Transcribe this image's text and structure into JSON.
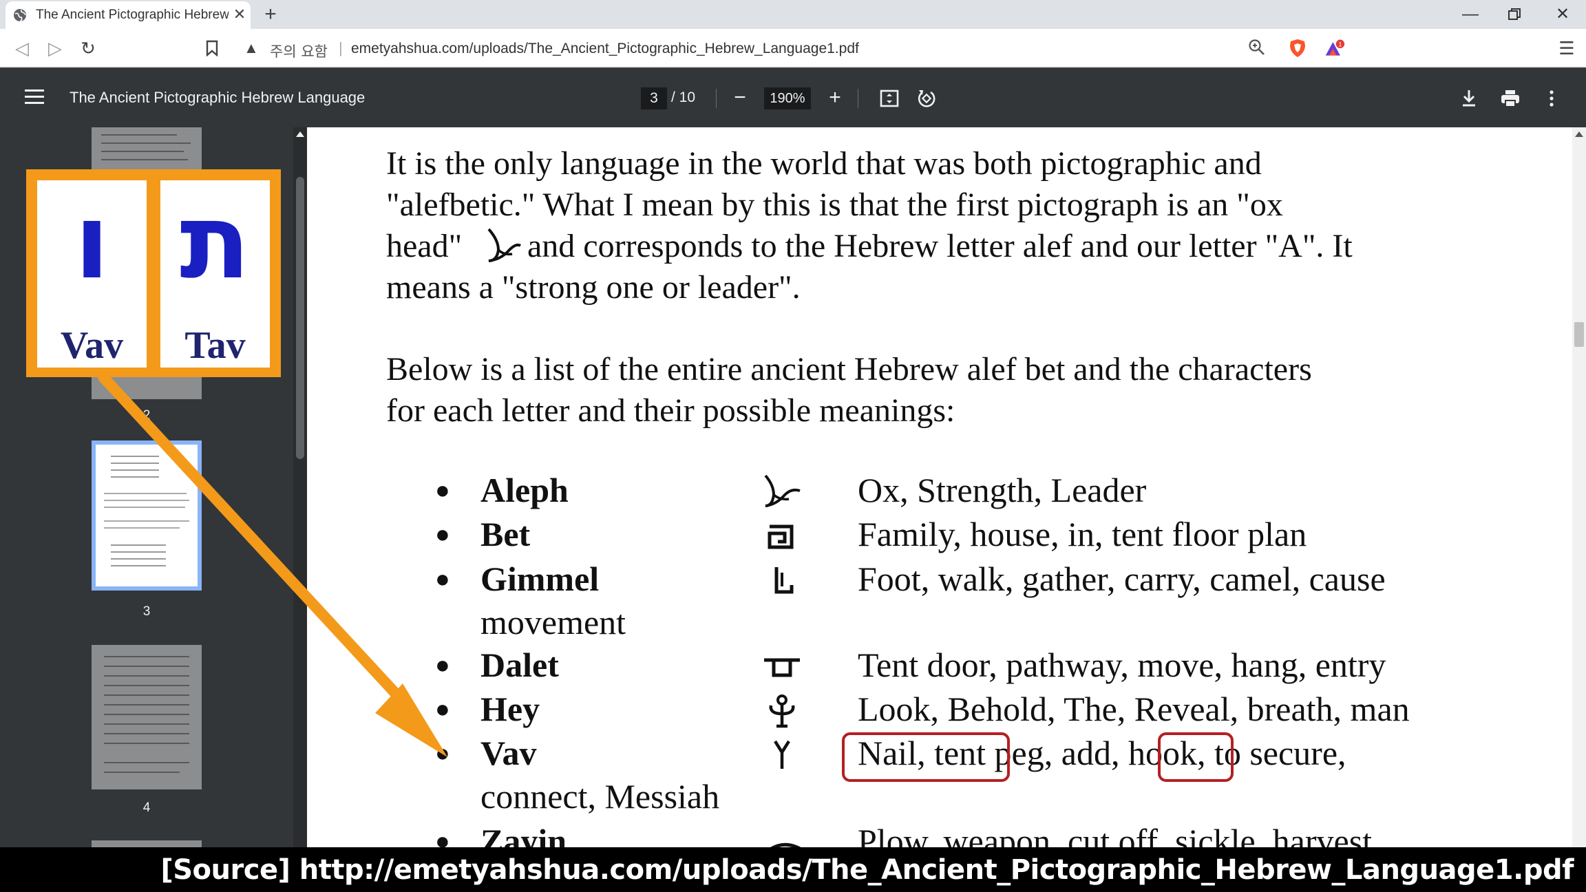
{
  "browser": {
    "tab_title": "The Ancient Pictographic Hebrew Language",
    "new_tab_icon": "plus-icon",
    "security_label": "주의 요함",
    "url": "emetyahshua.com/uploads/The_Ancient_Pictographic_Hebrew_Language1.pdf",
    "extensions": [
      "brave-shield-icon",
      "brave-rewards-icon"
    ]
  },
  "pdf_viewer": {
    "title": "The Ancient Pictographic Hebrew Language",
    "page_current": "3",
    "page_total": "/ 10",
    "zoom": "190%",
    "thumbnails": [
      {
        "label": "2"
      },
      {
        "label": "3",
        "selected": true
      },
      {
        "label": "4"
      }
    ]
  },
  "document": {
    "intro": "It is the only language in the world that was both pictographic and \"alefbetic.\" What I mean by this is that the first pictograph is an \"ox head\" and corresponds to the Hebrew letter alef and our letter \"A\". It means a \"strong one or leader\".",
    "intro_lines": [
      "It is the only language in the world that was both pictographic and",
      "\"alefbetic.\" What I mean by this is that the first pictograph is an \"ox",
      "head\"",
      "and corresponds to the Hebrew letter alef and our letter \"A\". It",
      "means a \"strong one or leader\"."
    ],
    "list_intro_lines": [
      "Below is a list of the entire ancient Hebrew alef bet and the characters",
      "for each letter and their possible meanings:"
    ],
    "letters": [
      {
        "name": "Aleph",
        "meaning": "Ox, Strength, Leader"
      },
      {
        "name": "Bet",
        "meaning": "Family, house, in, tent floor plan"
      },
      {
        "name": "Gimmel",
        "meaning": "Foot, walk, gather, carry, camel, cause",
        "continuation": "movement"
      },
      {
        "name": "Dalet",
        "meaning": "Tent door, pathway, move, hang, entry"
      },
      {
        "name": "Hey",
        "meaning": "Look, Behold, The, Reveal, breath, man"
      },
      {
        "name": "Vav",
        "meaning": "Nail, tent peg, add, hook, to secure,",
        "continuation": "connect, Messiah"
      },
      {
        "name": "Zayin",
        "meaning": "Plow, weapon, cut off, sickle, harvest"
      }
    ]
  },
  "inset": {
    "cards": [
      {
        "hebrew": "ו",
        "latin": "Vav"
      },
      {
        "hebrew": "ת",
        "latin": "Tav"
      }
    ],
    "color": "#f39a1b"
  },
  "source": "[Source]  http://emetyahshua.com/uploads/The_Ancient_Pictographic_Hebrew_Language1.pdf"
}
